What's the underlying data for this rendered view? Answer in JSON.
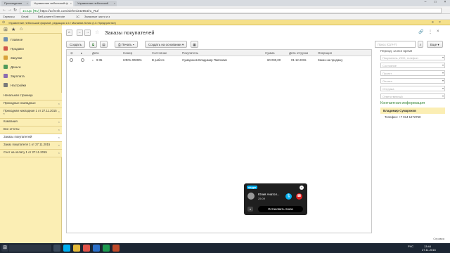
{
  "browser": {
    "tabs": [
      {
        "label": "Прохождение"
      },
      {
        "label": "Управление небольшой ф"
      },
      {
        "label": "Управление небольшой"
      }
    ],
    "url_secure": "1С:ЦС [RU]",
    "url_text": "https://1cfresh.com/a/ehm/242954/ru_RU/",
    "bookmarks": [
      "Сервисы",
      "Gmail",
      "Веб-клиент Evernote",
      "1С",
      "Запасные части и з"
    ],
    "app_title": "Управление небольшой фирмой, редакция 1.6 / Манаева Юлия (1С:Предприятие)"
  },
  "sidebar": {
    "sections": [
      {
        "label": "Главное",
        "color": "#6d8fb0"
      },
      {
        "label": "Продажи",
        "color": "#d0584a"
      },
      {
        "label": "Закупки",
        "color": "#d8a23a"
      },
      {
        "label": "Деньги",
        "color": "#4f9a5a"
      },
      {
        "label": "Зарплата",
        "color": "#8c6cb0"
      },
      {
        "label": "Настройки",
        "color": "#7a7a7a"
      }
    ],
    "open_items": [
      {
        "label": "Начальная страница"
      },
      {
        "label": "Приходные накладные"
      },
      {
        "label": "Приходная накладная 1 от 27.11.2015 *"
      },
      {
        "label": "Компания"
      },
      {
        "label": "Все отчеты"
      },
      {
        "label": "Заказы покупателей"
      },
      {
        "label": "Заказ покупателя 1 от 27.11.2015"
      },
      {
        "label": "Счет на оплату 1 от 27.11.2015"
      }
    ]
  },
  "page": {
    "title": "Заказы покупателей",
    "buttons": {
      "create": "Создать",
      "print": "Печать",
      "create_based_on": "Создать на основании",
      "more": "Еще"
    },
    "search_placeholder": "Поиск (Ctrl+F)"
  },
  "table": {
    "columns": [
      "Дата",
      "Номер",
      "Состояние",
      "Покупатель",
      "Сумма",
      "Дата отгрузки",
      "Операция"
    ],
    "rows": [
      {
        "date": "9:35",
        "number": "НФ01-000001",
        "state": "В работе",
        "customer": "Сумароков Владимир Павлович",
        "amount": "60 000,00",
        "ship_date": "01.12.2015",
        "operation": "Заказ на продажу"
      }
    ]
  },
  "filters": {
    "heading": "Период: за все время",
    "fields": [
      "Покупатель, ИНН, телефон",
      "Состояние",
      "Проект",
      "Оплата",
      "Отгрузка",
      "Ответственный"
    ]
  },
  "contact": {
    "title": "Контактная информация",
    "name": "Владимир Сумароков",
    "phone": "Телефон: +7 914 1272750"
  },
  "help_link": "Справка",
  "skype": {
    "logo": "skype",
    "caller": "Юлия Анатол...",
    "time": "25:09",
    "stop_label": "Остановить показ"
  },
  "taskbar": {
    "search_text": "",
    "lang": "РУС",
    "time": "13:44",
    "date": "27.11.2015"
  }
}
